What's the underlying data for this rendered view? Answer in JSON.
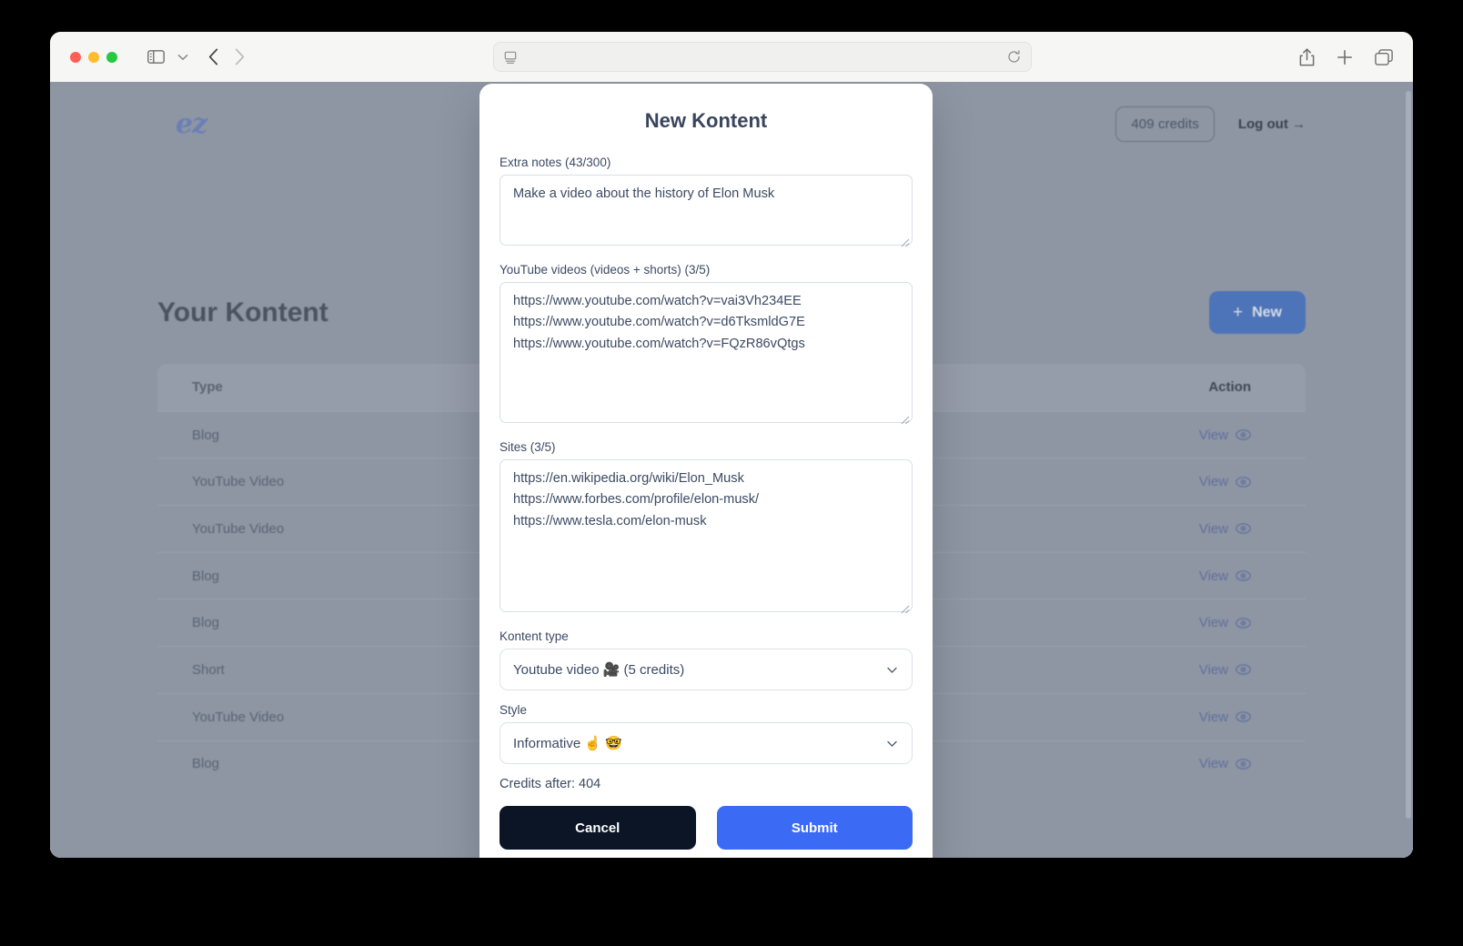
{
  "browser": {
    "address_bar_value": "",
    "address_bar_placeholder": "",
    "icons": {
      "sidebar": "sidebar-toggle-icon",
      "chevron": "chevron-down-icon",
      "back": "back-arrow-icon",
      "forward": "forward-arrow-icon",
      "reader": "reader-view-icon",
      "reload": "reload-icon",
      "share": "share-icon",
      "new_tab": "plus-icon",
      "tabs": "tab-overview-icon"
    }
  },
  "app": {
    "logo_text": "ez",
    "credits_badge": "409 credits",
    "logout_label": "Log out →",
    "page_title": "Your Kontent",
    "new_button_label": "New",
    "new_button_plus": "+",
    "table": {
      "columns": [
        "Type",
        "Action"
      ],
      "action_label": "View",
      "rows": [
        {
          "type": "Blog",
          "action": "View"
        },
        {
          "type": "YouTube Video",
          "action": "View"
        },
        {
          "type": "YouTube Video",
          "action": "View"
        },
        {
          "type": "Blog",
          "action": "View"
        },
        {
          "type": "Blog",
          "action": "View"
        },
        {
          "type": "Short",
          "action": "View"
        },
        {
          "type": "YouTube Video",
          "action": "View"
        },
        {
          "type": "Blog",
          "action": "View"
        }
      ]
    }
  },
  "modal": {
    "title": "New Kontent",
    "notes": {
      "label": "Extra notes (43/300)",
      "value": "Make a video about the history of Elon Musk"
    },
    "videos": {
      "label": "YouTube videos (videos + shorts) (3/5)",
      "value": "https://www.youtube.com/watch?v=vai3Vh234EE\nhttps://www.youtube.com/watch?v=d6TksmldG7E\nhttps://www.youtube.com/watch?v=FQzR86vQtgs"
    },
    "sites": {
      "label": "Sites (3/5)",
      "value": "https://en.wikipedia.org/wiki/Elon_Musk\nhttps://www.forbes.com/profile/elon-musk/\nhttps://www.tesla.com/elon-musk"
    },
    "kontent_type": {
      "label": "Kontent type",
      "selected": "Youtube video 🎥 (5 credits)"
    },
    "style": {
      "label": "Style",
      "selected": "Informative ☝️ 🤓"
    },
    "credits_after": "Credits after: 404",
    "cancel_label": "Cancel",
    "submit_label": "Submit"
  },
  "colors": {
    "accent_blue": "#3b6bf5",
    "cancel_dark": "#0b1526",
    "new_button": "#4d74b8",
    "overlay": "#8e96a4",
    "logo": "#6a7fb5"
  }
}
